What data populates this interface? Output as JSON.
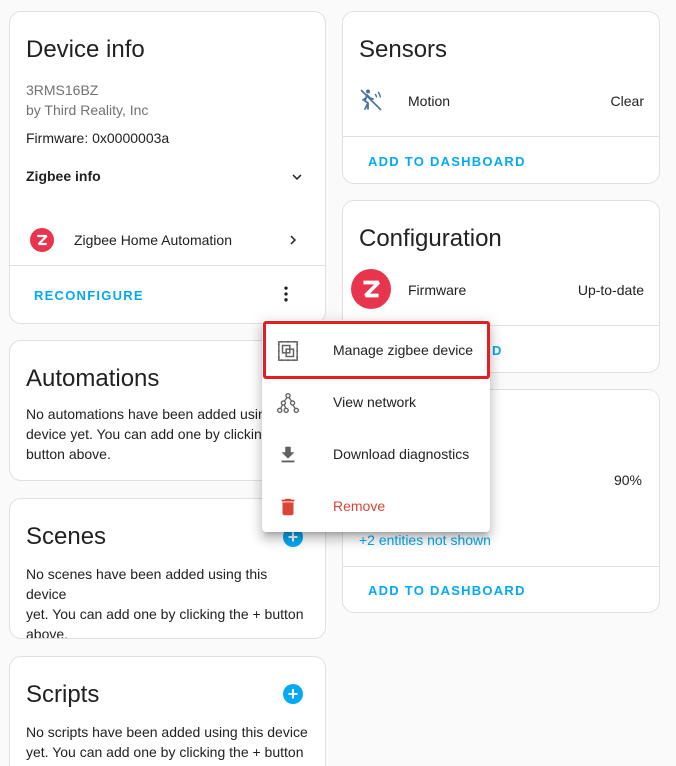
{
  "device_info": {
    "title": "Device info",
    "model": "3RMS16BZ",
    "manufacturer": "by Third Reality, Inc",
    "firmware": "Firmware: 0x0000003a",
    "zigbee_info_label": "Zigbee info",
    "integration_label": "Zigbee Home Automation",
    "reconfigure_label": "RECONFIGURE"
  },
  "sensors": {
    "title": "Sensors",
    "rows": [
      {
        "name": "Motion",
        "state": "Clear",
        "icon": "motion-sensor-off-icon"
      }
    ],
    "add_label": "ADD TO DASHBOARD"
  },
  "configuration": {
    "title": "Configuration",
    "rows": [
      {
        "name": "Firmware",
        "state": "Up-to-date",
        "icon": "zigbee-logo"
      }
    ],
    "add_label_partial": "D"
  },
  "diagnostic": {
    "value": "90%",
    "hidden_entities": "+2 entities not shown",
    "add_label": "ADD TO DASHBOARD"
  },
  "automations": {
    "title": "Automations",
    "lines": [
      "No automations have been added usin",
      "device yet. You can add one by clicking",
      "button above."
    ]
  },
  "scenes": {
    "title": "Scenes",
    "lines": [
      "No scenes have been added using this device",
      "yet. You can add one by clicking the + button",
      "above."
    ]
  },
  "scripts": {
    "title": "Scripts",
    "lines": [
      "No scripts have been added using this device",
      "yet. You can add one by clicking the + button"
    ]
  },
  "menu": {
    "items": [
      {
        "label": "Manage zigbee device",
        "icon": "manage-device-icon"
      },
      {
        "label": "View network",
        "icon": "network-icon"
      },
      {
        "label": "Download diagnostics",
        "icon": "download-icon"
      },
      {
        "label": "Remove",
        "icon": "delete-icon"
      }
    ]
  },
  "colors": {
    "accent": "#03a9f4",
    "zigbee": "#e8344d",
    "danger": "#db4437",
    "highlight": "#e41e1e"
  }
}
